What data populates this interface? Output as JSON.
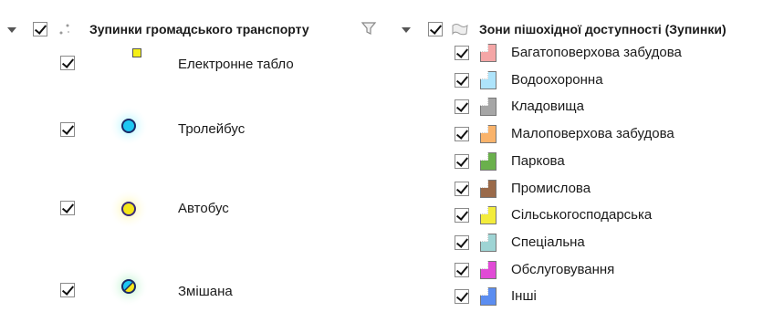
{
  "left_group": {
    "title": "Зупинки громадського транспорту",
    "items": [
      {
        "label": "Електронне табло",
        "symbol": "yellow-square-icon"
      },
      {
        "label": "Тролейбус",
        "symbol": "cyan-circle-icon"
      },
      {
        "label": "Автобус",
        "symbol": "yellow-circle-icon"
      },
      {
        "label": "Змішана",
        "symbol": "mixed-circle-icon"
      }
    ]
  },
  "right_group": {
    "title": "Зони пішохідної доступності (Зупинки)",
    "items": [
      {
        "label": "Багатоповерхова забудова",
        "color": "#f4a6a6"
      },
      {
        "label": "Водоохоронна",
        "color": "#aee4fb"
      },
      {
        "label": "Кладовища",
        "color": "#a6a6a6"
      },
      {
        "label": "Малоповерхова забудова",
        "color": "#f9b36b"
      },
      {
        "label": "Паркова",
        "color": "#6ab04c"
      },
      {
        "label": "Промислова",
        "color": "#9a6a4a"
      },
      {
        "label": "Сільськогосподарська",
        "color": "#f3ec3c"
      },
      {
        "label": "Спеціальна",
        "color": "#9ed4d4"
      },
      {
        "label": "Обслуговування",
        "color": "#e14bd6"
      },
      {
        "label": "Інші",
        "color": "#5b8df0"
      }
    ]
  }
}
